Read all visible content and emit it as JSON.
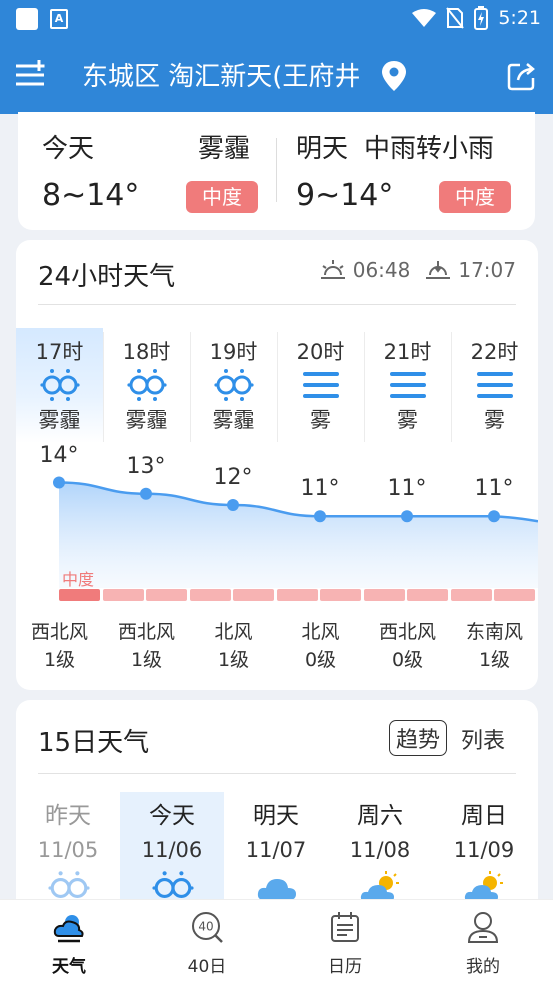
{
  "status_bar": {
    "time": "5:21",
    "app_badge": "A"
  },
  "header": {
    "location": "东城区 淘汇新天(王府井"
  },
  "today_summary": {
    "today": {
      "label": "今天",
      "weather": "雾霾",
      "temp": "8~14°",
      "aqi": "中度"
    },
    "tomorrow": {
      "label": "明天",
      "weather": "中雨转小雨",
      "temp": "9~14°",
      "aqi": "中度"
    }
  },
  "hourly": {
    "title": "24小时天气",
    "sunrise": "06:48",
    "sunset": "17:07",
    "aq_label": "中度",
    "hours": [
      {
        "time": "17时",
        "icon": "haze-icon",
        "desc": "雾霾",
        "temp": "14°",
        "temp_value": 14,
        "wind_dir": "西北风",
        "wind_level": "1级"
      },
      {
        "time": "18时",
        "icon": "haze-icon",
        "desc": "雾霾",
        "temp": "13°",
        "temp_value": 13,
        "wind_dir": "西北风",
        "wind_level": "1级"
      },
      {
        "time": "19时",
        "icon": "haze-icon",
        "desc": "雾霾",
        "temp": "12°",
        "temp_value": 12,
        "wind_dir": "北风",
        "wind_level": "1级"
      },
      {
        "time": "20时",
        "icon": "fog-icon",
        "desc": "雾",
        "temp": "11°",
        "temp_value": 11,
        "wind_dir": "北风",
        "wind_level": "0级"
      },
      {
        "time": "21时",
        "icon": "fog-icon",
        "desc": "雾",
        "temp": "11°",
        "temp_value": 11,
        "wind_dir": "西北风",
        "wind_level": "0级"
      },
      {
        "time": "22时",
        "icon": "fog-icon",
        "desc": "雾",
        "temp": "11°",
        "temp_value": 11,
        "wind_dir": "东南风",
        "wind_level": "1级"
      }
    ]
  },
  "daily": {
    "title": "15日天气",
    "toggle_trend": "趋势",
    "toggle_list": "列表",
    "days": [
      {
        "name": "昨天",
        "date": "11/05",
        "icon": "haze-icon"
      },
      {
        "name": "今天",
        "date": "11/06",
        "icon": "haze-icon"
      },
      {
        "name": "明天",
        "date": "11/07",
        "icon": "cloud-icon"
      },
      {
        "name": "周六",
        "date": "11/08",
        "icon": "partly-cloudy-icon"
      },
      {
        "name": "周日",
        "date": "11/09",
        "icon": "partly-cloudy-icon"
      }
    ]
  },
  "nav": {
    "items": [
      {
        "label": "天气",
        "icon": "weather-icon"
      },
      {
        "label": "40日",
        "icon": "forty-day-icon"
      },
      {
        "label": "日历",
        "icon": "calendar-icon"
      },
      {
        "label": "我的",
        "icon": "profile-icon"
      }
    ],
    "forty_badge": "40"
  },
  "colors": {
    "brand": "#2f86d8",
    "aqi_moderate": "#f07b7b",
    "icon_blue": "#2f8fe8"
  }
}
